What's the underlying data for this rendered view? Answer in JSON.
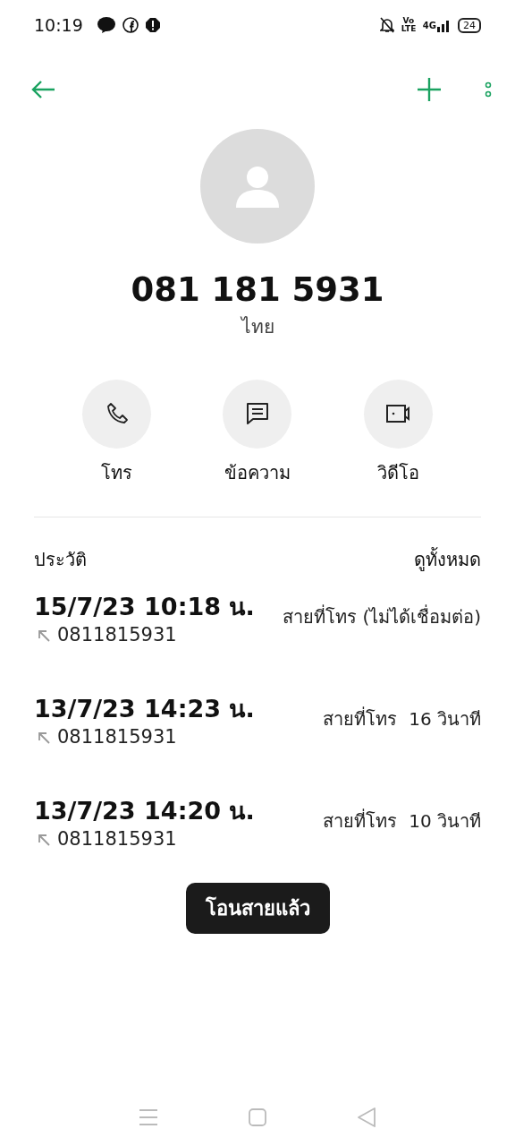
{
  "status_bar": {
    "time": "10:19",
    "volte": "Vo LTE",
    "network": "4G",
    "battery": "24"
  },
  "contact": {
    "number": "081 181 5931",
    "label": "ไทย"
  },
  "actions": [
    {
      "kind": "call",
      "label": "โทร"
    },
    {
      "kind": "message",
      "label": "ข้อความ"
    },
    {
      "kind": "video",
      "label": "วิดีโอ"
    }
  ],
  "history": {
    "title": "ประวัติ",
    "see_all": "ดูทั้งหมด",
    "entries": [
      {
        "datetime": "15/7/23 10:18 น.",
        "number": "0811815931",
        "kind": "outgoing",
        "detail": "สายที่โทร (ไม่ได้เชื่อมต่อ)"
      },
      {
        "datetime": "13/7/23 14:23 น.",
        "number": "0811815931",
        "kind": "outgoing",
        "detail": "สายที่โทร  16 วินาที"
      },
      {
        "datetime": "13/7/23 14:20 น.",
        "number": "0811815931",
        "kind": "outgoing",
        "detail": "สายที่โทร  10 วินาที"
      }
    ]
  },
  "toast": "โอนสายแล้ว"
}
